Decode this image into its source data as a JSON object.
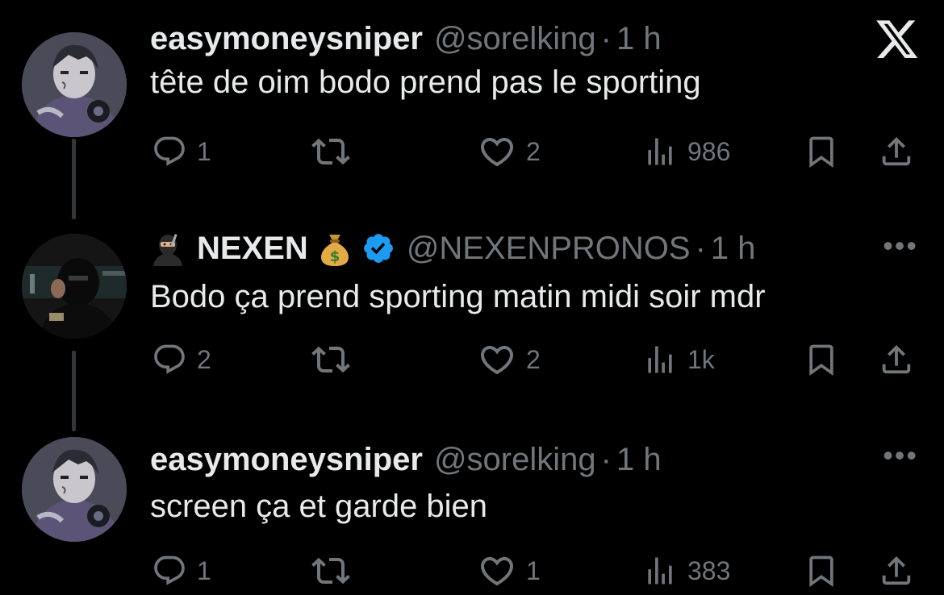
{
  "tweets": [
    {
      "name": "easymoneysniper",
      "handle": "@sorelking",
      "separator": "·",
      "time": "1 h",
      "text": "tête de oim bodo prend pas le sporting",
      "replies": "1",
      "retweets": "",
      "likes": "2",
      "views": "986",
      "corner_icon": "x-logo-icon"
    },
    {
      "name": "NEXEN",
      "name_prefix_emoji": "ninja-emoji",
      "name_suffix_emoji": "money-bag-emoji",
      "verified": true,
      "handle": "@NEXENPRONOS",
      "separator": "·",
      "time": "1 h",
      "text": "Bodo ça prend sporting matin midi soir mdr",
      "replies": "2",
      "retweets": "",
      "likes": "2",
      "views": "1k",
      "corner_icon": "more-icon",
      "more_label": "•••"
    },
    {
      "name": "easymoneysniper",
      "handle": "@sorelking",
      "separator": "·",
      "time": "1 h",
      "text": "screen ça et garde bien",
      "replies": "1",
      "retweets": "",
      "likes": "1",
      "views": "383",
      "corner_icon": "more-icon",
      "more_label": "•••"
    }
  ],
  "colors": {
    "background": "#000000",
    "text": "#e7e9ea",
    "muted": "#71767b",
    "verified": "#1d9bf0",
    "thread_line": "#333639"
  }
}
